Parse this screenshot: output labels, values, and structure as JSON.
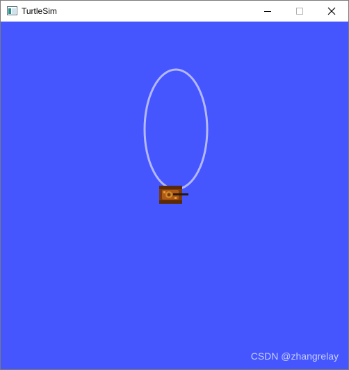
{
  "window": {
    "title": "TurtleSim",
    "app_icon": "window-app-icon",
    "buttons": {
      "minimize_icon": "minimize-icon",
      "maximize_icon": "maximize-icon",
      "close_icon": "close-icon"
    }
  },
  "canvas": {
    "background_color": "#4556ff",
    "trail_color": "#b4b8ff",
    "turtle_icon": "turtle-tank-icon"
  },
  "watermark": {
    "text": "CSDN @zhangrelay"
  }
}
